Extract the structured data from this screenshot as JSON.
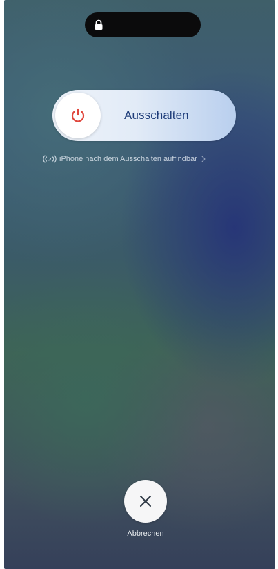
{
  "status_bar": {
    "lock_icon": "lock-icon"
  },
  "power_slider": {
    "label": "Ausschalten",
    "icon": "power-icon",
    "accent_color": "#e0473d"
  },
  "find_my": {
    "text": "iPhone nach dem Ausschalten auffindbar",
    "icon": "find-my-signal-icon"
  },
  "cancel": {
    "label": "Abbrechen",
    "icon": "close-icon"
  }
}
